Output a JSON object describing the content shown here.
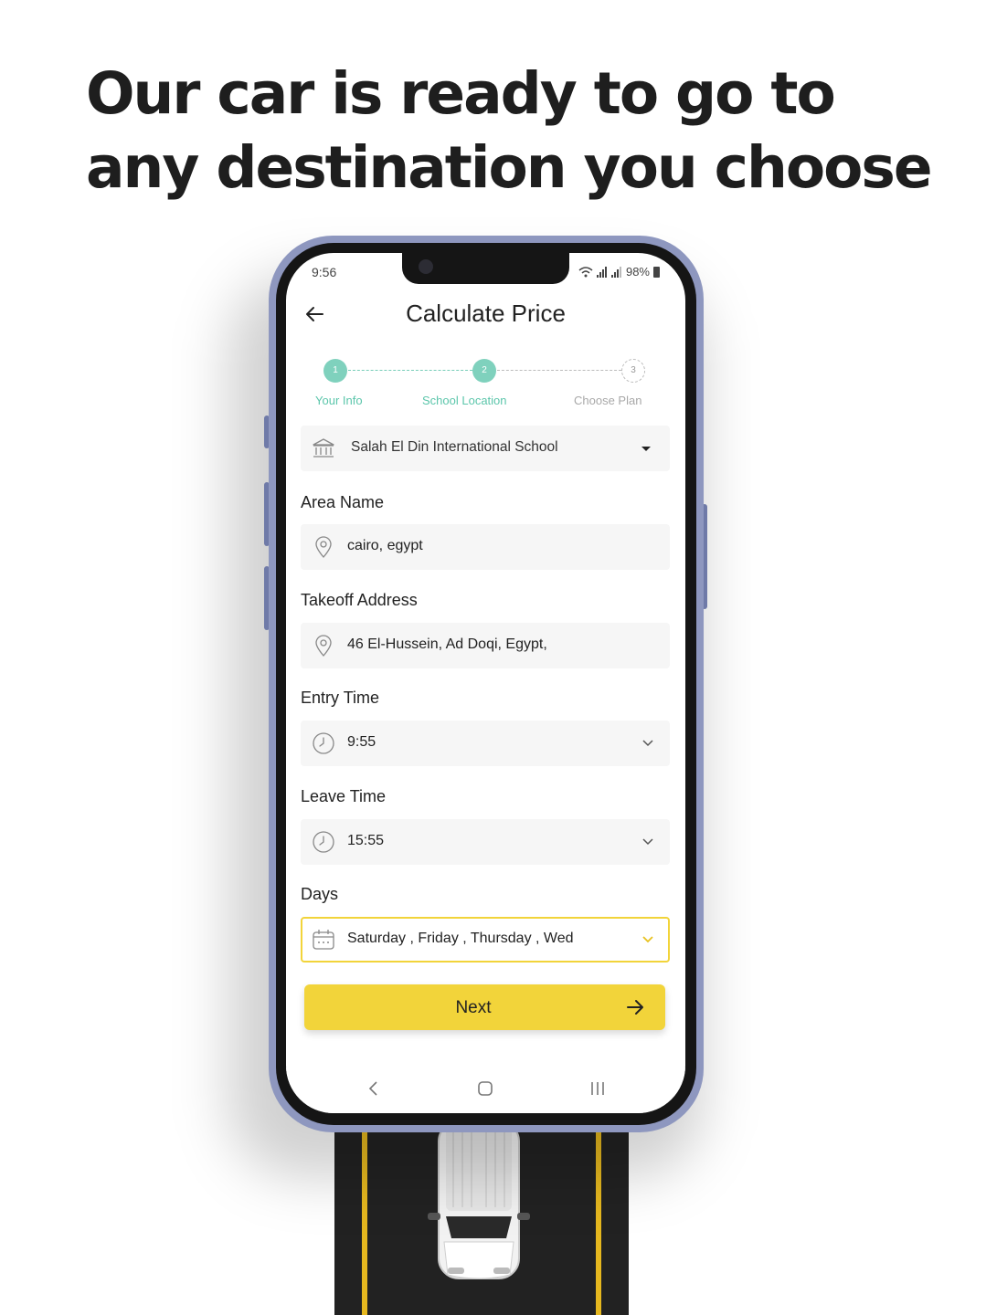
{
  "headline": {
    "line1": "Our car is ready to go to",
    "line2": "any destination you choose"
  },
  "status_bar": {
    "time": "9:56",
    "battery": "98%"
  },
  "header": {
    "title": "Calculate Price"
  },
  "stepper": {
    "steps": [
      {
        "number": "1",
        "label": "Your Info",
        "state": "done"
      },
      {
        "number": "2",
        "label": "School Location",
        "state": "active"
      },
      {
        "number": "3",
        "label": "Choose Plan",
        "state": "pending"
      }
    ]
  },
  "form": {
    "school": {
      "value": "Salah El Din International School",
      "icon": "school-building-icon"
    },
    "area": {
      "label": "Area Name",
      "value": "cairo, egypt",
      "icon": "location-pin-icon"
    },
    "takeoff": {
      "label": "Takeoff Address",
      "value": "46 El-Hussein, Ad Doqi, Egypt,",
      "icon": "location-pin-icon"
    },
    "entry_time": {
      "label": "Entry Time",
      "value": "9:55",
      "icon": "clock-icon"
    },
    "leave_time": {
      "label": "Leave Time",
      "value": "15:55",
      "icon": "clock-icon"
    },
    "days": {
      "label": "Days",
      "value": "Saturday , Friday , Thursday , Wed",
      "icon": "calendar-icon"
    }
  },
  "next_button": {
    "label": "Next"
  },
  "colors": {
    "accent_yellow": "#f2d43a",
    "stepper_green": "#7fd1bd",
    "phone_frame": "#8e97bf"
  }
}
